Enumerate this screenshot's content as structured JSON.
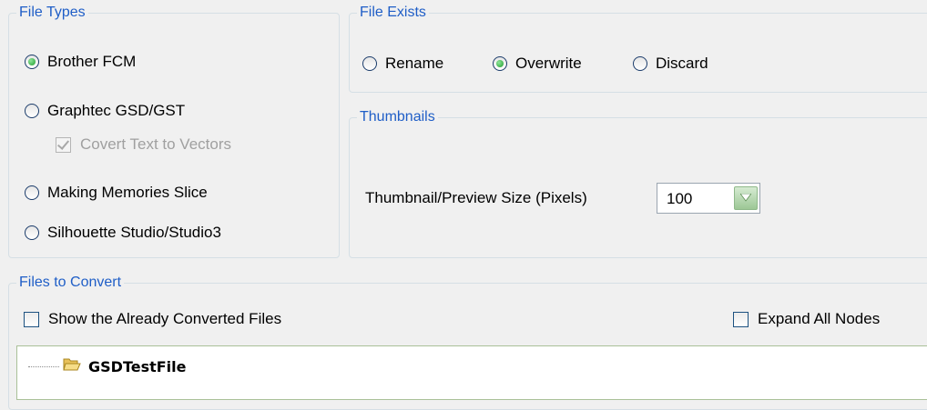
{
  "file_types": {
    "title": "File Types",
    "options": [
      {
        "label": "Brother FCM",
        "selected": true
      },
      {
        "label": "Graphtec GSD/GST",
        "selected": false
      },
      {
        "label": "Making Memories Slice",
        "selected": false
      },
      {
        "label": "Silhouette Studio/Studio3",
        "selected": false
      }
    ],
    "convert_text": {
      "label": "Covert Text to Vectors",
      "checked": true,
      "enabled": false
    }
  },
  "file_exists": {
    "title": "File Exists",
    "options": [
      {
        "label": "Rename",
        "selected": false
      },
      {
        "label": "Overwrite",
        "selected": true
      },
      {
        "label": "Discard",
        "selected": false
      }
    ]
  },
  "thumbnails": {
    "title": "Thumbnails",
    "size_label": "Thumbnail/Preview Size (Pixels)",
    "size_value": "100"
  },
  "files_to_convert": {
    "title": "Files to Convert",
    "show_converted": {
      "label": "Show the Already Converted Files",
      "checked": false
    },
    "expand_all": {
      "label": "Expand All Nodes",
      "checked": false
    },
    "tree": [
      {
        "label": "GSDTestFile",
        "icon": "folder-open-icon"
      }
    ]
  }
}
